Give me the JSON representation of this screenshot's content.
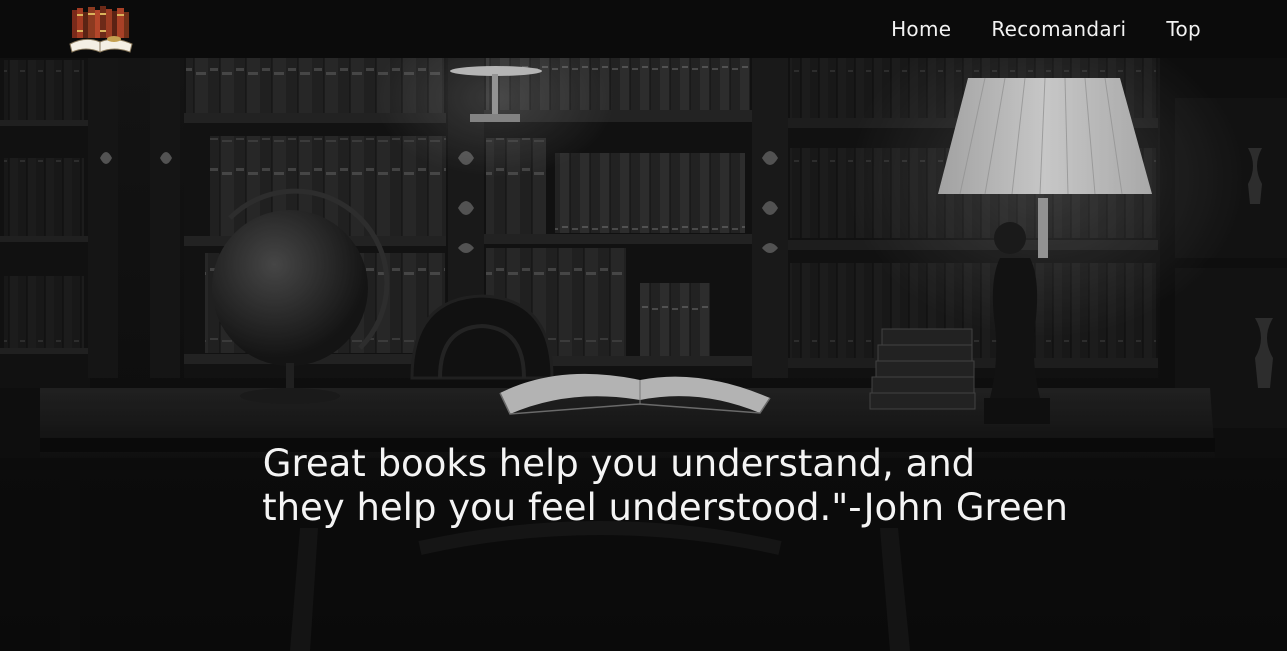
{
  "navbar": {
    "logo": {
      "icon": "books-logo-icon"
    },
    "links": [
      {
        "label": "Home"
      },
      {
        "label": "Recomandari"
      },
      {
        "label": "Top"
      }
    ]
  },
  "hero": {
    "background": "dark library room with bookshelves, globe, lamp, open book on desk",
    "quote": {
      "line1": "Great books help you understand, and",
      "line2": "they help you feel understood.\"-John Green"
    }
  },
  "colors": {
    "navbar_bg": "#0b0b0b",
    "text": "#f2f2f2",
    "hero_bg": "#141414"
  }
}
